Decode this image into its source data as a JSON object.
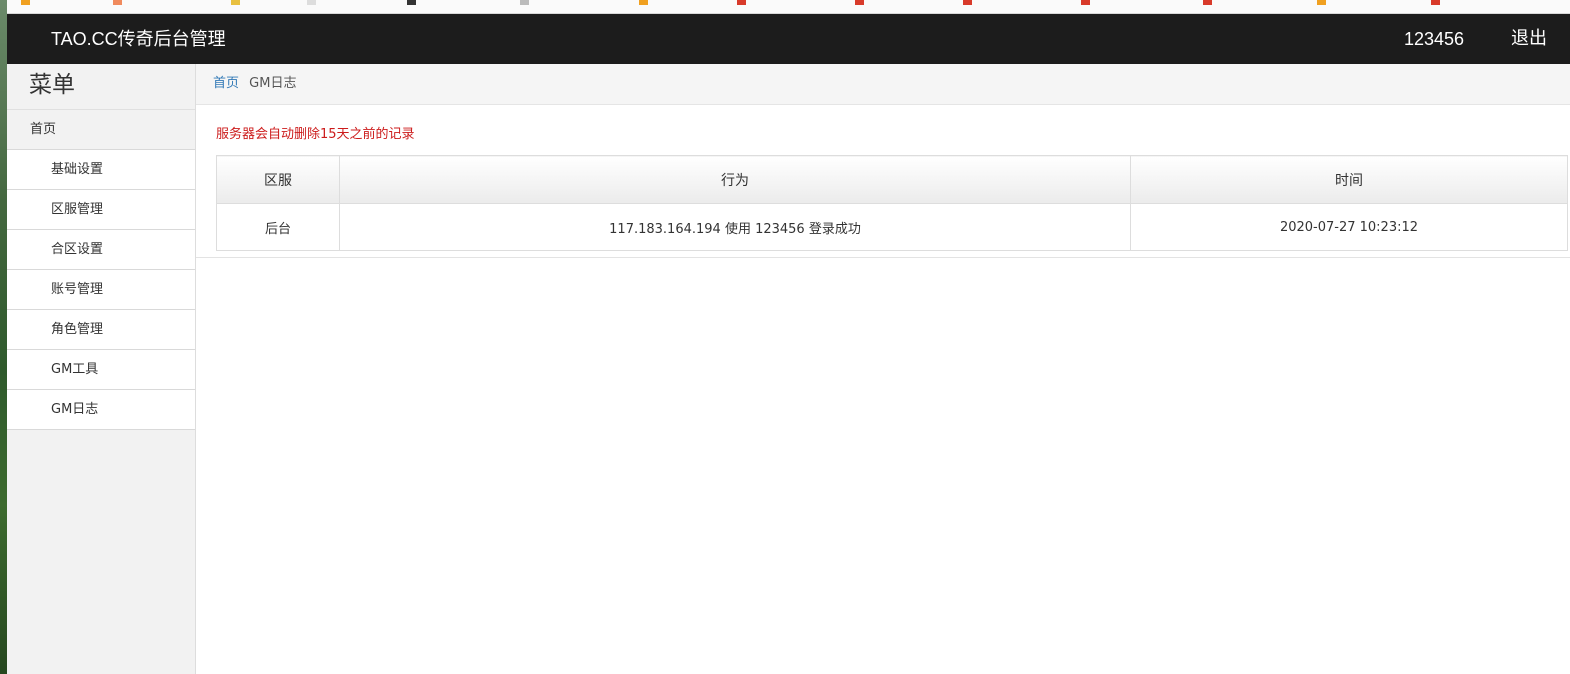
{
  "header": {
    "brand": "TAO.CC传奇后台管理",
    "username": "123456",
    "logout_label": "退出"
  },
  "sidebar": {
    "title": "菜单",
    "home": "首页",
    "items": [
      {
        "label": "基础设置"
      },
      {
        "label": "区服管理"
      },
      {
        "label": "合区设置"
      },
      {
        "label": "账号管理"
      },
      {
        "label": "角色管理"
      },
      {
        "label": "GM工具"
      },
      {
        "label": "GM日志"
      }
    ]
  },
  "breadcrumb": {
    "home": "首页",
    "current": "GM日志"
  },
  "notice": "服务器会自动删除15天之前的记录",
  "table": {
    "columns": [
      "区服",
      "行为",
      "时间"
    ],
    "rows": [
      {
        "server": "后台",
        "action": "117.183.164.194 使用 123456 登录成功",
        "time": "2020-07-27 10:23:12"
      }
    ]
  },
  "colors": {
    "header_bg": "#1c1c1c",
    "notice": "#cc1b1b",
    "link": "#337ab7"
  }
}
